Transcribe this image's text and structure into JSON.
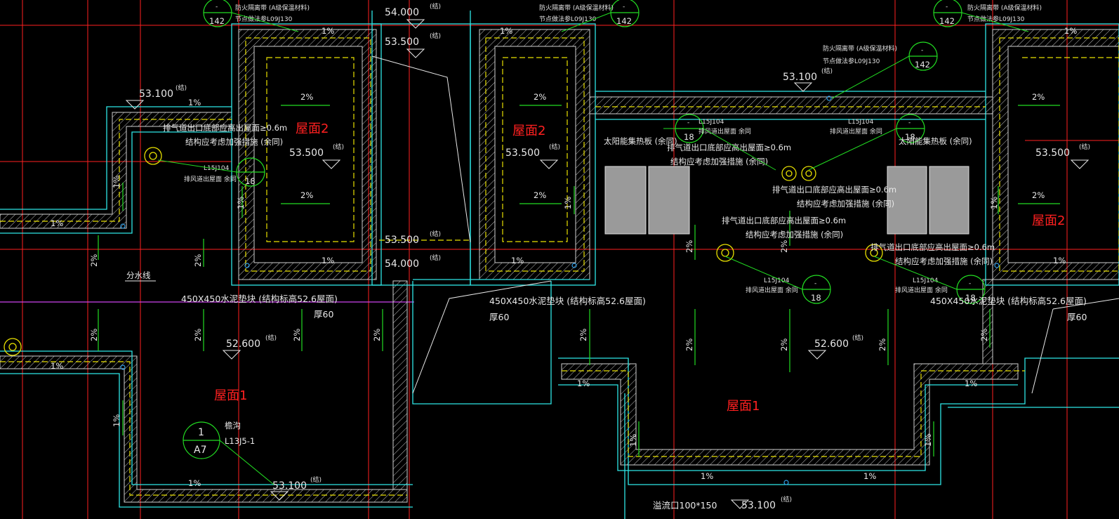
{
  "roof_labels": {
    "roof1": "屋面1",
    "roof2": "屋面2"
  },
  "elevations": {
    "e54000": "54.000",
    "e53500": "53.500",
    "e53100": "53.100",
    "e52600": "52.600",
    "struct_mark": "(结)"
  },
  "slopes": {
    "one_pct": "1%",
    "two_pct": "2%"
  },
  "notes": {
    "firebreak": "防火隔离带 (A级保温材料)",
    "node_ref": "节点做法参L09J130",
    "exhaust_outlet": "排气道出口底部应高出屋面≥0.6m",
    "structure_reinforce": "结构应考虑加强措施 (余同)",
    "solar_panel": "太阳能集热板 (余同)",
    "vent_detail_ref": "L15J104",
    "vent_detail_note": "排风道出屋面 余同",
    "cement_block": "450X450水泥垫块 (结构标高52.6屋面)",
    "thickness": "厚60",
    "divide_line": "分水线",
    "gutter": "檐沟",
    "gutter_ref": "L13J5-1",
    "overflow": "溢流口100*150"
  },
  "callouts": {
    "c142": "142",
    "c18": "18",
    "c1": "1",
    "a7": "A7",
    "dash": "-"
  },
  "colors": {
    "background": "#000000",
    "wall_outline": "#2ee6e6",
    "grid_axis": "#ff2020",
    "membrane_dash": "#e8e000",
    "slope_arrow": "#22dd22",
    "partition": "#cc44ee",
    "callout": "#22dd22",
    "solar_panel": "#9a9a9a"
  }
}
